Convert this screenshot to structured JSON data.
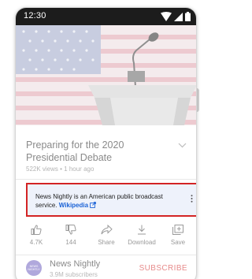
{
  "status_bar": {
    "time": "12:30"
  },
  "video": {
    "title": "Preparing for the 2020 Presidential Debate",
    "meta": "522K views • 1 hour ago"
  },
  "info_panel": {
    "text": "News Nightly is an American public broadcast service.",
    "link": "Wikipedia"
  },
  "actions": [
    {
      "label": "4.7K",
      "icon": "thumbs-up-icon"
    },
    {
      "label": "144",
      "icon": "thumbs-down-icon"
    },
    {
      "label": "Share",
      "icon": "share-icon"
    },
    {
      "label": "Download",
      "icon": "download-icon"
    },
    {
      "label": "Save",
      "icon": "save-icon"
    }
  ],
  "channel": {
    "avatar_line1": "NEWS",
    "avatar_line2": "NIGHTLY",
    "name": "News Nightly",
    "subscribers": "3.9M subscribers",
    "subscribe_label": "SUBSCRIBE"
  },
  "colors": {
    "highlight_border": "#d32424",
    "link": "#1a62d6",
    "subscribe": "#e78b8b",
    "avatar": "#b0a8dc"
  }
}
